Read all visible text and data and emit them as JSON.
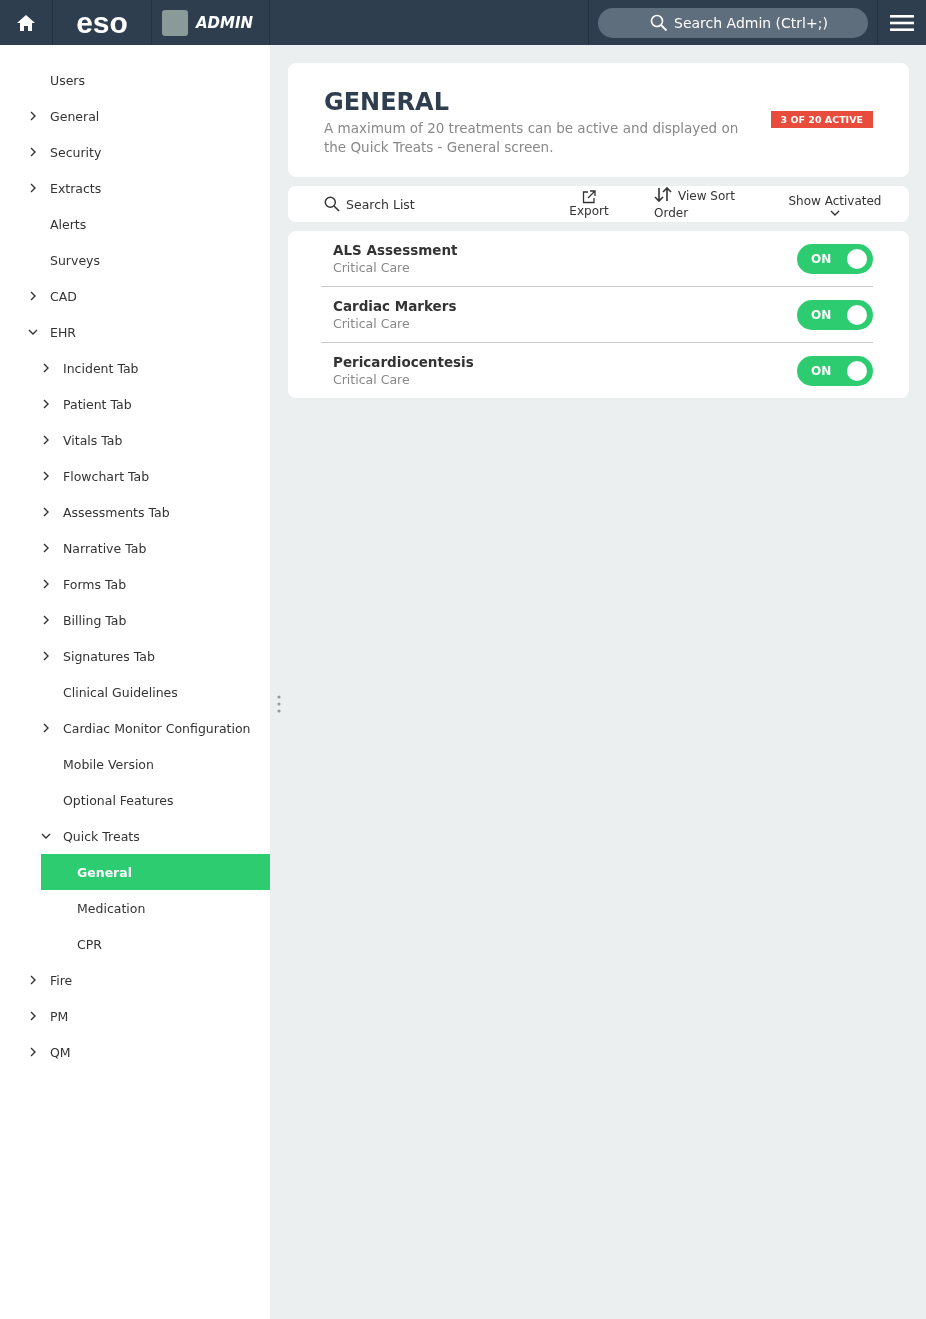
{
  "header": {
    "logo": "eso",
    "app_label": "ADMIN",
    "search": {
      "placeholder": "Search Admin (Ctrl+;)"
    }
  },
  "sidebar": {
    "items": [
      {
        "label": "Users",
        "selected": false
      },
      {
        "label": "General",
        "selected": false,
        "expanded": false
      },
      {
        "label": "Security",
        "selected": false,
        "expanded": false
      },
      {
        "label": "Extracts",
        "selected": false,
        "expanded": false
      },
      {
        "label": "Alerts",
        "selected": false
      },
      {
        "label": "Surveys",
        "selected": false
      },
      {
        "label": "CAD",
        "selected": false,
        "expanded": false
      },
      {
        "label": "EHR",
        "selected": false,
        "expanded": true,
        "children": [
          {
            "label": "Incident Tab",
            "selected": false,
            "expanded": false
          },
          {
            "label": "Patient Tab",
            "selected": false,
            "expanded": false
          },
          {
            "label": "Vitals Tab",
            "selected": false,
            "expanded": false
          },
          {
            "label": "Flowchart Tab",
            "selected": false,
            "expanded": false
          },
          {
            "label": "Assessments Tab",
            "selected": false,
            "expanded": false
          },
          {
            "label": "Narrative Tab",
            "selected": false,
            "expanded": false
          },
          {
            "label": "Forms Tab",
            "selected": false,
            "expanded": false
          },
          {
            "label": "Billing Tab",
            "selected": false,
            "expanded": false
          },
          {
            "label": "Signatures Tab",
            "selected": false,
            "expanded": false
          },
          {
            "label": "Clinical Guidelines",
            "selected": false
          },
          {
            "label": "Cardiac Monitor Configuration",
            "selected": false,
            "expanded": false
          },
          {
            "label": "Mobile Version",
            "selected": false
          },
          {
            "label": "Optional Features",
            "selected": false
          },
          {
            "label": "Quick Treats",
            "selected": false,
            "expanded": true,
            "children": [
              {
                "label": "General",
                "selected": true
              },
              {
                "label": "Medication",
                "selected": false
              },
              {
                "label": "CPR",
                "selected": false
              }
            ]
          }
        ]
      },
      {
        "label": "Fire",
        "selected": false,
        "expanded": false
      },
      {
        "label": "PM",
        "selected": false,
        "expanded": false
      },
      {
        "label": "QM",
        "selected": false,
        "expanded": false
      }
    ]
  },
  "page": {
    "title": "GENERAL",
    "description": "A maximum of 20 treatments can be active and displayed on the Quick Treats - General screen.",
    "badge": "3 OF 20 ACTIVE"
  },
  "toolbar": {
    "search": {
      "placeholder": "Search List"
    },
    "export": "Export",
    "sort": "View Sort Order",
    "filter": "Show Activated"
  },
  "treatments": [
    {
      "name": "ALS Assessment",
      "category": "Critical Care",
      "on": true,
      "toggle_label": "ON"
    },
    {
      "name": "Cardiac Markers",
      "category": "Critical Care",
      "on": true,
      "toggle_label": "ON"
    },
    {
      "name": "Pericardiocentesis",
      "category": "Critical Care",
      "on": true,
      "toggle_label": "ON"
    }
  ]
}
